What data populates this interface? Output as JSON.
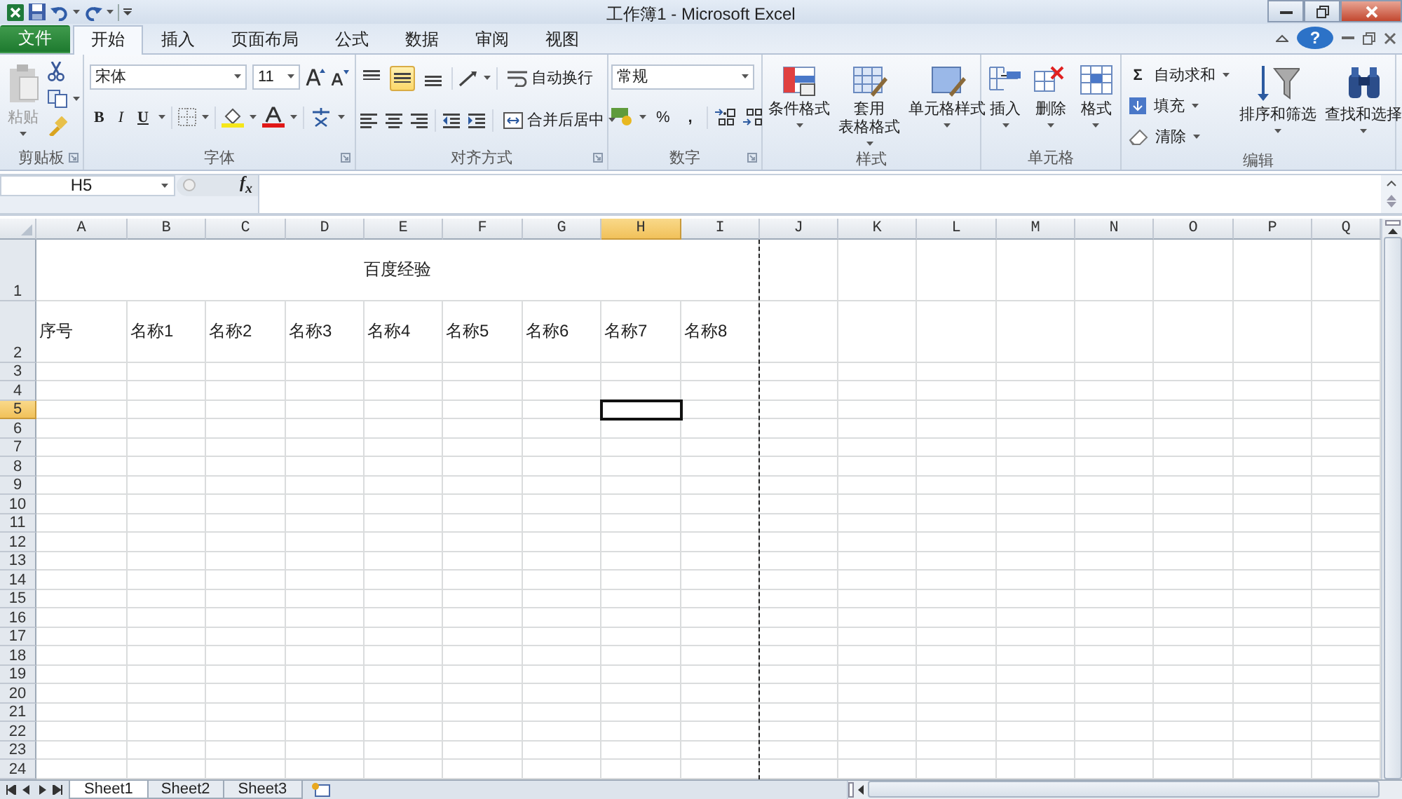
{
  "title_bar": {
    "title": "工作簿1 - Microsoft Excel"
  },
  "ribbon_tabs": [
    {
      "label": "文件",
      "kind": "file",
      "selected": false
    },
    {
      "label": "开始",
      "kind": "tab",
      "selected": true
    },
    {
      "label": "插入",
      "kind": "tab",
      "selected": false
    },
    {
      "label": "页面布局",
      "kind": "tab",
      "selected": false
    },
    {
      "label": "公式",
      "kind": "tab",
      "selected": false
    },
    {
      "label": "数据",
      "kind": "tab",
      "selected": false
    },
    {
      "label": "审阅",
      "kind": "tab",
      "selected": false
    },
    {
      "label": "视图",
      "kind": "tab",
      "selected": false
    }
  ],
  "help": "?",
  "clipboard": {
    "label": "剪贴板",
    "paste": {
      "label": "粘贴",
      "disabled": true
    }
  },
  "font": {
    "label": "字体",
    "name": "宋体",
    "size": "11",
    "bold": "B",
    "italic": "I",
    "underline": "U"
  },
  "alignment": {
    "label": "对齐方式",
    "vertical": [
      {
        "selected": false
      },
      {
        "selected": true
      },
      {
        "selected": false
      }
    ],
    "wrap": "自动换行",
    "merge": "合并后居中"
  },
  "number": {
    "label": "数字",
    "format": "常规",
    "percent": "%",
    "comma": ","
  },
  "styles": {
    "label": "样式",
    "items": [
      {
        "lines": [
          "条件格式"
        ]
      },
      {
        "lines": [
          "套用",
          "表格格式"
        ]
      },
      {
        "lines": [
          "单元格样式"
        ]
      }
    ]
  },
  "cells": {
    "label": "单元格",
    "items": [
      "插入",
      "删除",
      "格式"
    ]
  },
  "editing": {
    "label": "编辑",
    "small": [
      {
        "symbol": "Σ",
        "label": "自动求和"
      },
      {
        "label": "填充"
      },
      {
        "label": "清除"
      }
    ],
    "large": [
      "排序和筛选",
      "查找和选择"
    ]
  },
  "formula_bar": {
    "name_box": "H5",
    "function_label": "f$_{x}$"
  },
  "sheet": {
    "columns": [
      {
        "label": "A",
        "selected": false
      },
      {
        "label": "B",
        "selected": false
      },
      {
        "label": "C",
        "selected": false
      },
      {
        "label": "D",
        "selected": false
      },
      {
        "label": "E",
        "selected": false
      },
      {
        "label": "F",
        "selected": false
      },
      {
        "label": "G",
        "selected": false
      },
      {
        "label": "H",
        "selected": true
      },
      {
        "label": "I",
        "selected": false,
        "page_break": true
      },
      {
        "label": "J",
        "selected": false
      },
      {
        "label": "K",
        "selected": false
      },
      {
        "label": "L",
        "selected": false
      },
      {
        "label": "M",
        "selected": false
      },
      {
        "label": "N",
        "selected": false
      },
      {
        "label": "O",
        "selected": false
      },
      {
        "label": "P",
        "selected": false
      },
      {
        "label": "Q",
        "selected": false
      }
    ],
    "rows": [
      {
        "header": "1",
        "selected": false,
        "kind": "merged-title",
        "title": "百度经验"
      },
      {
        "header": "2",
        "selected": false,
        "kind": "values",
        "cells": [
          "序号",
          "名称1",
          "名称2",
          "名称3",
          "名称4",
          "名称5",
          "名称6",
          "名称7",
          "名称8"
        ]
      },
      {
        "header": "3",
        "selected": false
      },
      {
        "header": "4",
        "selected": false
      },
      {
        "header": "5",
        "selected": true
      },
      {
        "header": "6",
        "selected": false
      },
      {
        "header": "7",
        "selected": false
      },
      {
        "header": "8",
        "selected": false
      },
      {
        "header": "9",
        "selected": false
      },
      {
        "header": "10",
        "selected": false
      },
      {
        "header": "11",
        "selected": false
      },
      {
        "header": "12",
        "selected": false
      },
      {
        "header": "13",
        "selected": false
      },
      {
        "header": "14",
        "selected": false
      },
      {
        "header": "15",
        "selected": false
      },
      {
        "header": "16",
        "selected": false
      },
      {
        "header": "17",
        "selected": false
      },
      {
        "header": "18",
        "selected": false
      },
      {
        "header": "19",
        "selected": false
      },
      {
        "header": "20",
        "selected": false
      },
      {
        "header": "21",
        "selected": false
      },
      {
        "header": "22",
        "selected": false
      },
      {
        "header": "23",
        "selected": false
      },
      {
        "header": "24",
        "selected": false
      }
    ]
  },
  "sheet_tabs": [
    {
      "label": "Sheet1",
      "selected": true
    },
    {
      "label": "Sheet2",
      "selected": false
    },
    {
      "label": "Sheet3",
      "selected": false
    }
  ]
}
